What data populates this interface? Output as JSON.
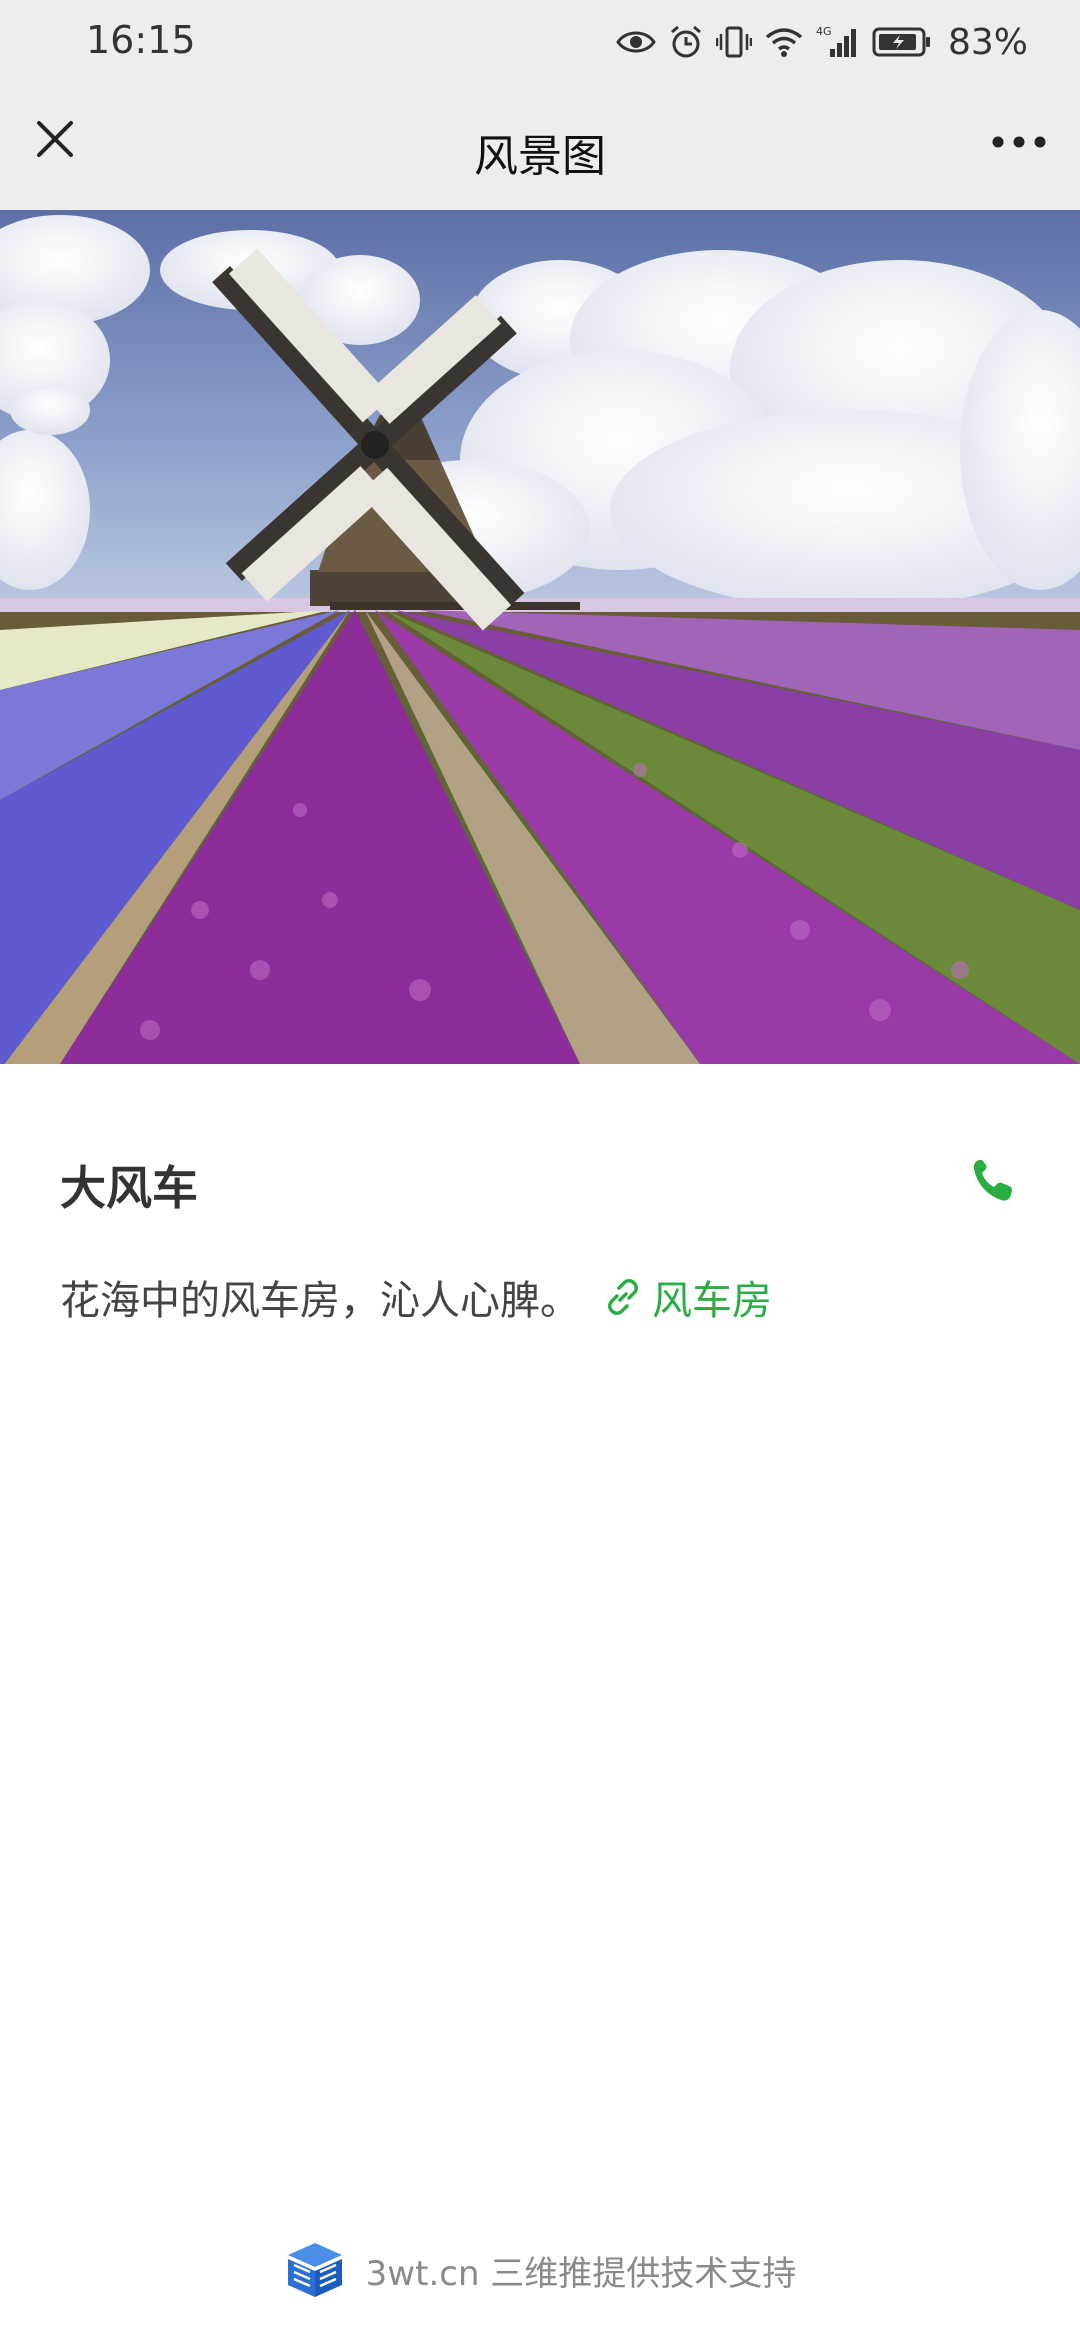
{
  "status_bar": {
    "time": "16:15",
    "network_label": "4G",
    "battery_percent": "83%"
  },
  "nav": {
    "title": "风景图"
  },
  "hero": {
    "description": "Windmill in a field of purple and blue hyacinth flowers under a cloudy sky"
  },
  "content": {
    "title": "大风车",
    "description": "花海中的风车房，沁人心脾。",
    "link_label": "风车房"
  },
  "footer": {
    "text": "3wt.cn 三维推提供技术支持"
  },
  "colors": {
    "accent_green": "#2aae43",
    "bar_bg": "#ededed"
  }
}
